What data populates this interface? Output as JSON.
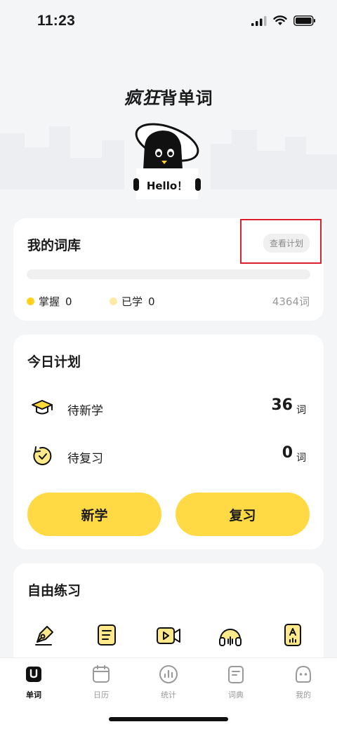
{
  "status_bar": {
    "time": "11:23",
    "icons": [
      "signal-icon",
      "wifi-icon",
      "battery-icon"
    ]
  },
  "header": {
    "logo_part1": "疯狂",
    "logo_part2": "背单词",
    "mascot_text": "Hello！"
  },
  "library": {
    "title": "我的词库",
    "plan_button": "查看计划",
    "progress": 0,
    "mastered_label": "掌握",
    "mastered_value": "0",
    "learned_label": "已学",
    "learned_value": "0",
    "total_words": "4364词",
    "colors": {
      "mastered": "#ffd21e",
      "learned": "#fdeaa5"
    }
  },
  "today": {
    "title": "今日计划",
    "rows": [
      {
        "label": "待新学",
        "count": "36",
        "unit": "词",
        "icon": "graduation-cap-icon"
      },
      {
        "label": "待复习",
        "count": "0",
        "unit": "词",
        "icon": "review-clock-icon"
      }
    ],
    "learn_button": "新学",
    "review_button": "复习"
  },
  "free_practice": {
    "title": "自由练习",
    "items": [
      {
        "label": "",
        "icon": "pen-nib-icon"
      },
      {
        "label": "",
        "icon": "document-icon"
      },
      {
        "label": "",
        "icon": "video-icon"
      },
      {
        "label": "",
        "icon": "headphones-icon"
      },
      {
        "label": "",
        "icon": "letter-card-icon"
      }
    ]
  },
  "tabs": [
    {
      "label": "单词",
      "icon": "word-book-icon",
      "active": true
    },
    {
      "label": "日历",
      "icon": "calendar-icon",
      "active": false
    },
    {
      "label": "统计",
      "icon": "stats-icon",
      "active": false
    },
    {
      "label": "词典",
      "icon": "dictionary-icon",
      "active": false
    },
    {
      "label": "我的",
      "icon": "profile-icon",
      "active": false
    }
  ],
  "accent_color": "#ffda45"
}
